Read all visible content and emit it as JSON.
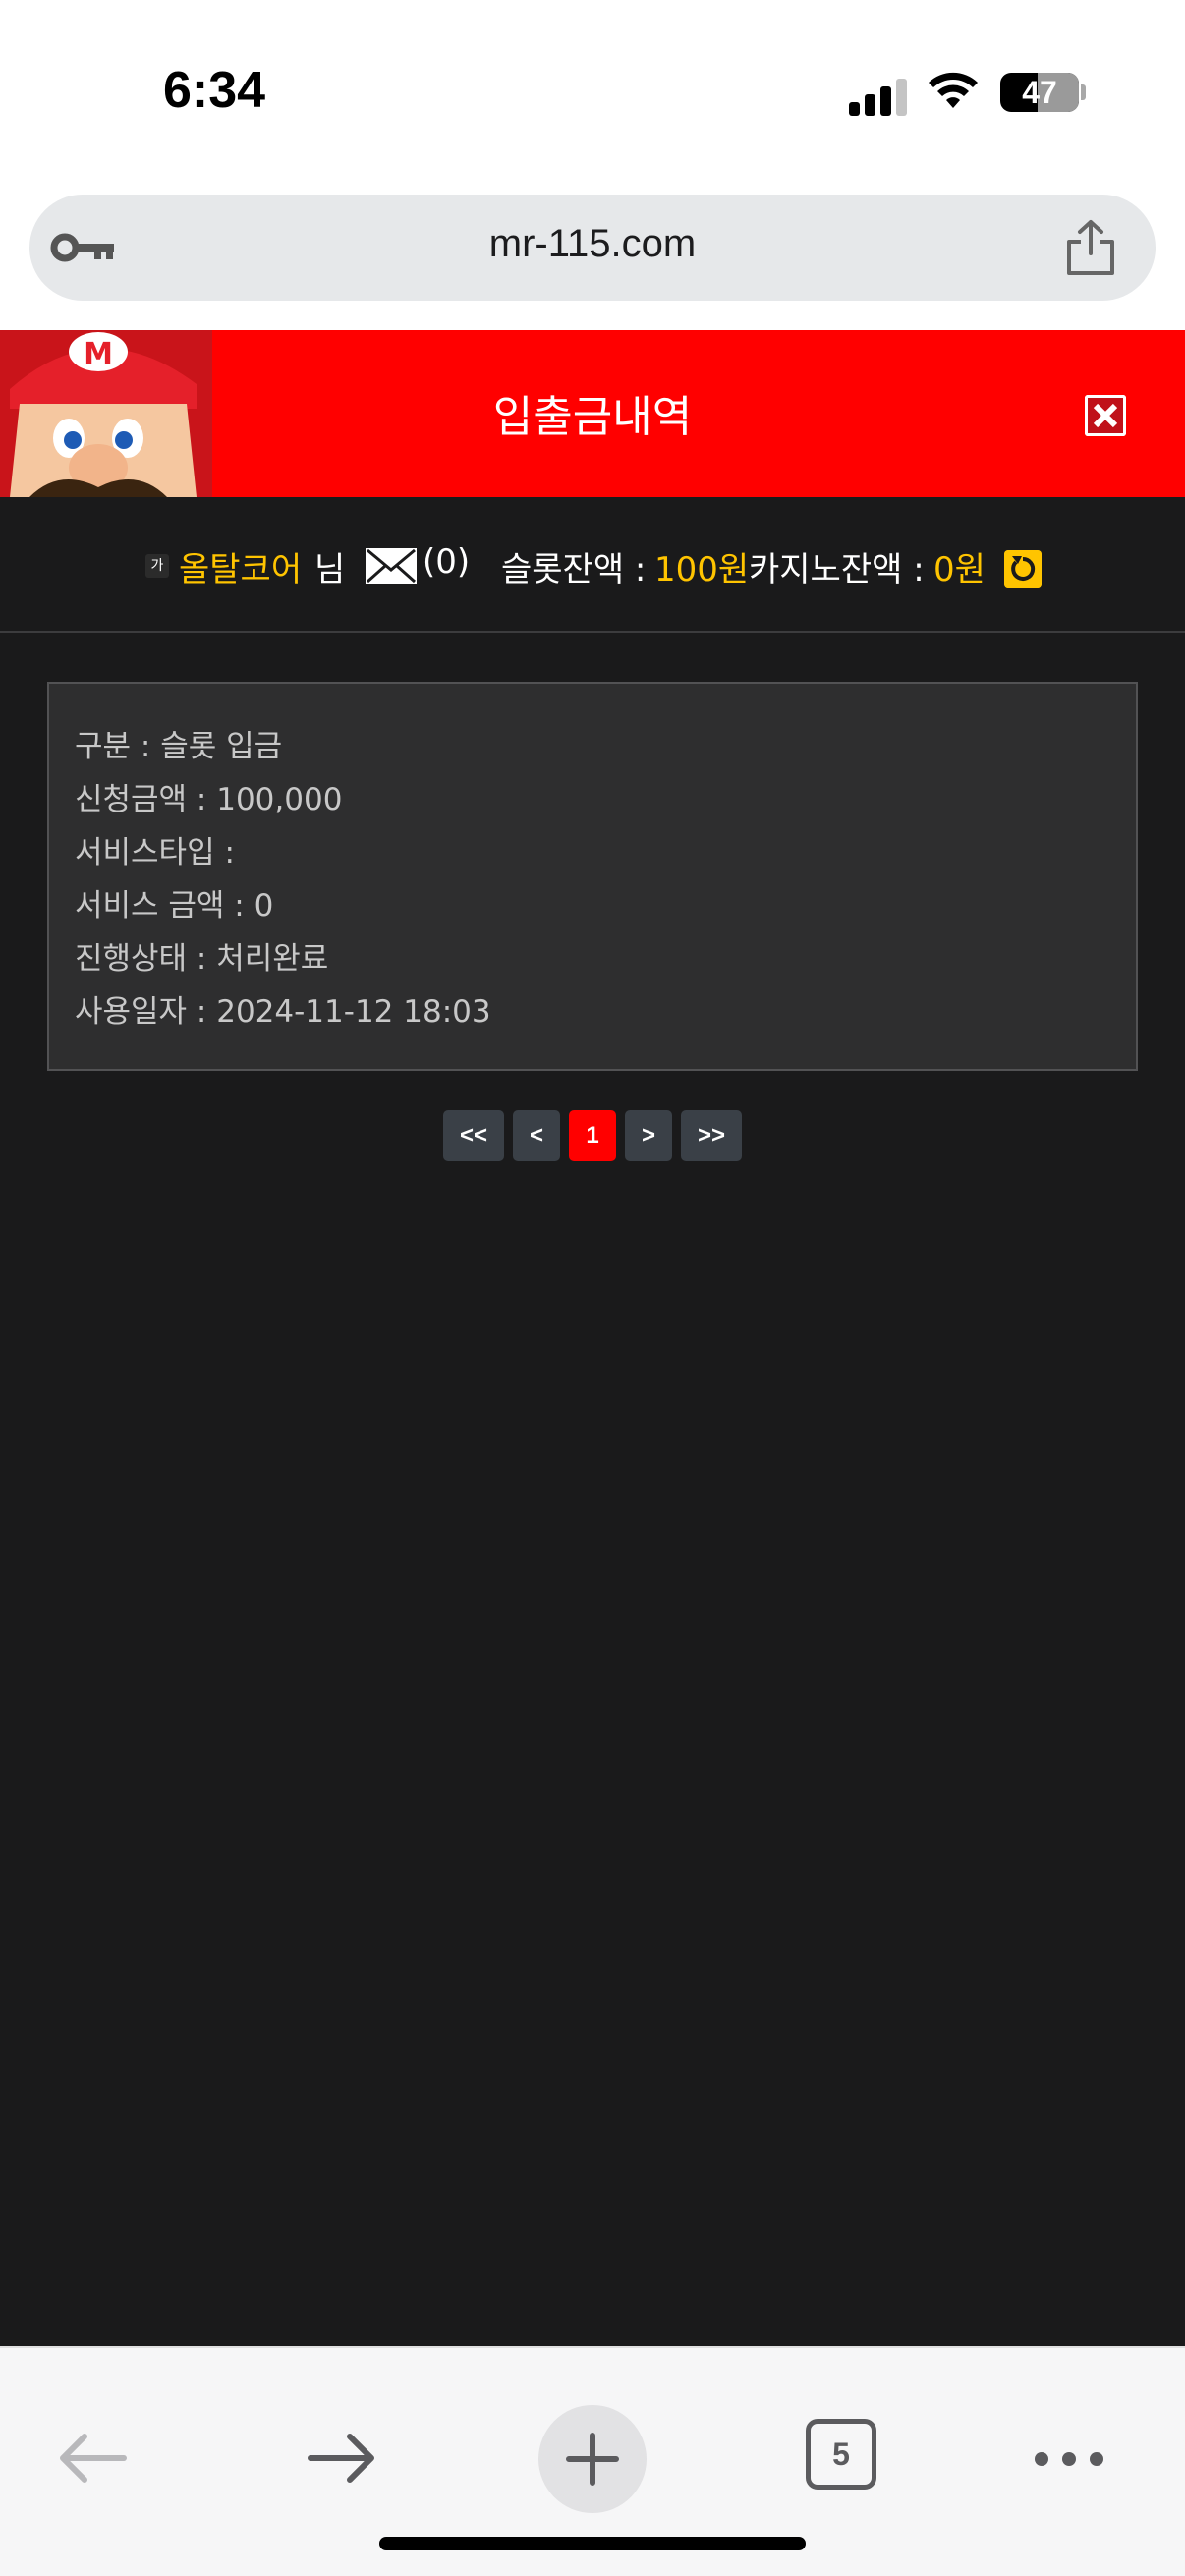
{
  "status_bar": {
    "time": "6:34",
    "battery": "47",
    "battery_level": 0.47
  },
  "browser": {
    "url": "mr-115.com",
    "open_tabs": "5"
  },
  "header": {
    "title": "입출금내역"
  },
  "user_bar": {
    "badge": "가",
    "username": "올탈코어",
    "honorific": "님",
    "mail_count": "(0)",
    "slot_label": "슬롯잔액 :",
    "slot_value": "100원",
    "casino_label": "카지노잔액 :",
    "casino_value": "0원"
  },
  "record": {
    "type": "구분 : 슬롯 입금",
    "amount": "신청금액 : 100,000",
    "service_type": "서비스타입 :",
    "service_amount": "서비스 금액 : 0",
    "status": "진행상태 : 처리완료",
    "date": "사용일자 : 2024-11-12 18:03"
  },
  "pagination": {
    "first": "<<",
    "prev": "<",
    "current": "1",
    "next": ">",
    "last": ">>"
  },
  "colors": {
    "accent_red": "#ff0000",
    "highlight_yellow": "#ffc400",
    "background_dark": "#1a1a1b"
  }
}
